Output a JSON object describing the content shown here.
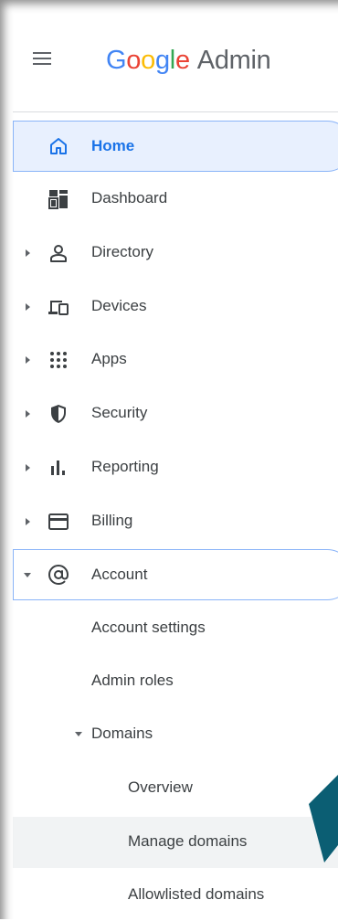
{
  "header": {
    "logo_letters": [
      "G",
      "o",
      "o",
      "g",
      "l",
      "e"
    ],
    "product": "Admin"
  },
  "nav": {
    "home": "Home",
    "dashboard": "Dashboard",
    "directory": "Directory",
    "devices": "Devices",
    "apps": "Apps",
    "security": "Security",
    "reporting": "Reporting",
    "billing": "Billing",
    "account": "Account"
  },
  "account_sub": {
    "account_settings": "Account settings",
    "admin_roles": "Admin roles",
    "domains": "Domains",
    "domains_sub": {
      "overview": "Overview",
      "manage_domains": "Manage domains",
      "allowlisted_domains": "Allowlisted domains"
    }
  },
  "colors": {
    "accent": "#1a73e8",
    "active_bg": "#e8f0fe",
    "active_border": "#8ab4f8",
    "icon": "#3c4043",
    "pointer": "#0b5e73"
  },
  "icons": {
    "home": "home-icon",
    "dashboard": "dashboard-icon",
    "directory": "person-icon",
    "devices": "devices-icon",
    "apps": "apps-grid-icon",
    "security": "shield-icon",
    "reporting": "bar-chart-icon",
    "billing": "credit-card-icon",
    "account": "at-sign-icon"
  }
}
